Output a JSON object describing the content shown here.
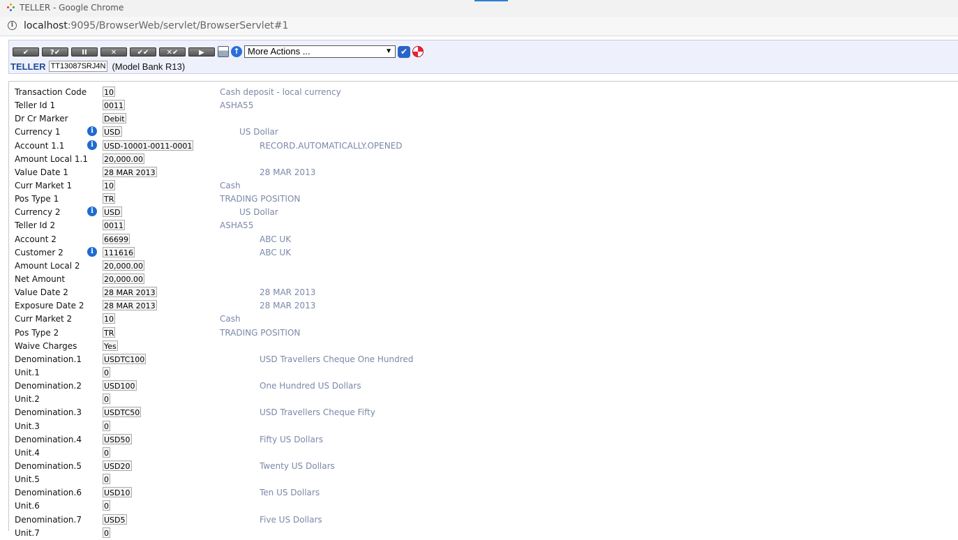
{
  "window": {
    "title": "TELLER - Google Chrome",
    "url_host": "localhost",
    "url_path": ":9095/BrowserWeb/servlet/BrowserServlet#1"
  },
  "toolbar": {
    "buttons": [
      {
        "name": "validate-button",
        "glyph": "✔"
      },
      {
        "name": "validate-query-button",
        "glyph": "?✔"
      },
      {
        "name": "hold-button",
        "glyph": "II"
      },
      {
        "name": "delete-button",
        "glyph": "✕"
      },
      {
        "name": "authorise-button",
        "glyph": "✔✔"
      },
      {
        "name": "reverse-button",
        "glyph": "✕✔"
      },
      {
        "name": "next-button",
        "glyph": "▶"
      }
    ],
    "more_actions": "More Actions ...",
    "commit_icon": "checkmark-icon",
    "help_icon": "lifebuoy-icon"
  },
  "header": {
    "app_name": "TELLER",
    "txn_id": "TT13087SRJ4N",
    "company": "(Model Bank R13)"
  },
  "colors": {
    "enrichment": "#7a88a8",
    "info_icon": "#1f6bcf",
    "app_name": "#1e4c9a"
  },
  "fields": [
    {
      "label": "Transaction Code",
      "value": "10",
      "desc": "Cash deposit - local currency",
      "info": false,
      "desc_col": "a"
    },
    {
      "label": "Teller Id 1",
      "value": "0011",
      "desc": "ASHA55",
      "info": false,
      "desc_col": "a"
    },
    {
      "label": "Dr Cr Marker",
      "value": "Debit",
      "desc": "",
      "info": false,
      "desc_col": "a"
    },
    {
      "label": "Currency 1",
      "value": "USD",
      "desc": "US Dollar",
      "info": true,
      "desc_col": "b"
    },
    {
      "label": "Account 1.1",
      "value": "USD-10001-0011-0001",
      "desc": "RECORD.AUTOMATICALLY.OPENED",
      "info": true,
      "desc_col": "c"
    },
    {
      "label": "Amount Local 1.1",
      "value": "20,000.00",
      "desc": "",
      "info": false,
      "desc_col": "a"
    },
    {
      "label": "Value Date 1",
      "value": "28 MAR 2013",
      "desc": "28 MAR 2013",
      "info": false,
      "desc_col": "c"
    },
    {
      "label": "Curr Market 1",
      "value": "10",
      "desc": "Cash",
      "info": false,
      "desc_col": "a"
    },
    {
      "label": "Pos Type 1",
      "value": "TR",
      "desc": "TRADING POSITION",
      "info": false,
      "desc_col": "a"
    },
    {
      "label": "Currency 2",
      "value": "USD",
      "desc": "US Dollar",
      "info": true,
      "desc_col": "b"
    },
    {
      "label": "Teller Id 2",
      "value": "0011",
      "desc": "ASHA55",
      "info": false,
      "desc_col": "a"
    },
    {
      "label": "Account 2",
      "value": "66699",
      "desc": "ABC UK",
      "info": false,
      "desc_col": "c"
    },
    {
      "label": "Customer 2",
      "value": "111616",
      "desc": "ABC UK",
      "info": true,
      "desc_col": "c"
    },
    {
      "label": "Amount Local 2",
      "value": "20,000.00",
      "desc": "",
      "info": false,
      "desc_col": "a"
    },
    {
      "label": "Net Amount",
      "value": "20,000.00",
      "desc": "",
      "info": false,
      "desc_col": "a"
    },
    {
      "label": "Value Date 2",
      "value": "28 MAR 2013",
      "desc": "28 MAR 2013",
      "info": false,
      "desc_col": "c"
    },
    {
      "label": "Exposure Date 2",
      "value": "28 MAR 2013",
      "desc": "28 MAR 2013",
      "info": false,
      "desc_col": "c"
    },
    {
      "label": "Curr Market 2",
      "value": "10",
      "desc": "Cash",
      "info": false,
      "desc_col": "a"
    },
    {
      "label": "Pos Type 2",
      "value": "TR",
      "desc": "TRADING POSITION",
      "info": false,
      "desc_col": "a"
    },
    {
      "label": "Waive Charges",
      "value": "Yes",
      "desc": "",
      "info": false,
      "desc_col": "a"
    },
    {
      "label": "Denomination.1",
      "value": "USDTC100",
      "desc": "USD Travellers Cheque One Hundred",
      "info": false,
      "desc_col": "c"
    },
    {
      "label": "Unit.1",
      "value": "0",
      "desc": "",
      "info": false,
      "desc_col": "a"
    },
    {
      "label": "Denomination.2",
      "value": "USD100",
      "desc": "One Hundred US Dollars",
      "info": false,
      "desc_col": "c"
    },
    {
      "label": "Unit.2",
      "value": "0",
      "desc": "",
      "info": false,
      "desc_col": "a"
    },
    {
      "label": "Denomination.3",
      "value": "USDTC50",
      "desc": "USD Travellers Cheque Fifty",
      "info": false,
      "desc_col": "c"
    },
    {
      "label": "Unit.3",
      "value": "0",
      "desc": "",
      "info": false,
      "desc_col": "a"
    },
    {
      "label": "Denomination.4",
      "value": "USD50",
      "desc": "Fifty US Dollars",
      "info": false,
      "desc_col": "c"
    },
    {
      "label": "Unit.4",
      "value": "0",
      "desc": "",
      "info": false,
      "desc_col": "a"
    },
    {
      "label": "Denomination.5",
      "value": "USD20",
      "desc": "Twenty US Dollars",
      "info": false,
      "desc_col": "c"
    },
    {
      "label": "Unit.5",
      "value": "0",
      "desc": "",
      "info": false,
      "desc_col": "a"
    },
    {
      "label": "Denomination.6",
      "value": "USD10",
      "desc": "Ten US Dollars",
      "info": false,
      "desc_col": "c"
    },
    {
      "label": "Unit.6",
      "value": "0",
      "desc": "",
      "info": false,
      "desc_col": "a"
    },
    {
      "label": "Denomination.7",
      "value": "USD5",
      "desc": "Five US Dollars",
      "info": false,
      "desc_col": "c"
    },
    {
      "label": "Unit.7",
      "value": "0",
      "desc": "",
      "info": false,
      "desc_col": "a"
    }
  ]
}
